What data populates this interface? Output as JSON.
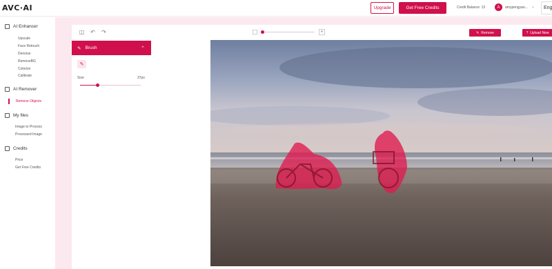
{
  "header": {
    "logo": "AVC·AI",
    "upgrade_label": "Upgrade",
    "get_credits_label": "Get Free Credits",
    "credit_balance": "Credit Balance: 13",
    "avatar_initial": "A",
    "username": "amypengyao...",
    "language": "Engl"
  },
  "sidebar": {
    "sections": [
      {
        "title": "AI Enhancer",
        "items": [
          "Upscale",
          "Face Retouch",
          "Denoise",
          "RemoveBG",
          "Colorize",
          "Calibrate"
        ]
      },
      {
        "title": "AI Remover",
        "items": [
          "Remove Objects"
        ]
      },
      {
        "title": "My files",
        "items": [
          "Image to Process",
          "Processed Image"
        ]
      },
      {
        "title": "Credits",
        "items": [
          "Price",
          "Get Free Credits"
        ]
      }
    ]
  },
  "toolbar": {
    "remove_label": "Remove",
    "upload_label": "Upload New"
  },
  "brush_panel": {
    "title": "Brush",
    "size_label": "Size",
    "size_value": "37px",
    "size_fraction": 0.28
  },
  "canvas": {
    "description_icon": "image-canvas",
    "mask_color": "#e0194f"
  },
  "colors": {
    "accent": "#d0104c",
    "background": "#fbe9ef"
  }
}
